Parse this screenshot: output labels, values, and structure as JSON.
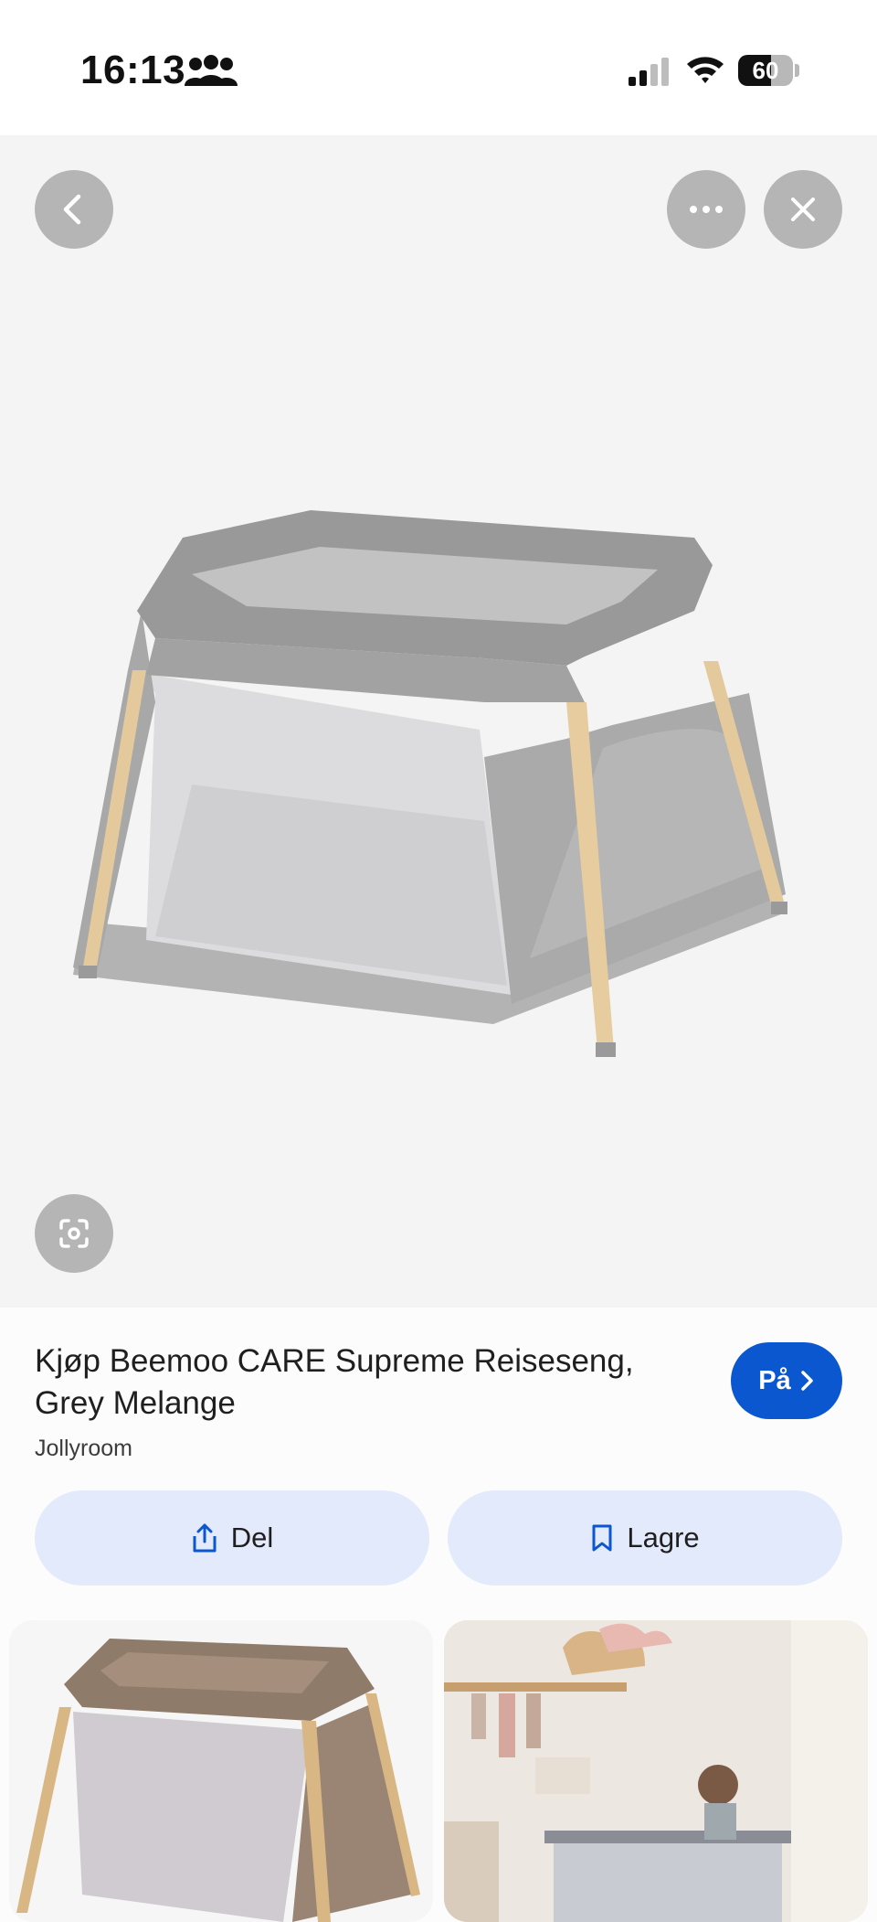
{
  "status_bar": {
    "time": "16:13",
    "people_icon": "people-icon",
    "battery_level": "60",
    "battery_fraction": 0.6
  },
  "image_viewer": {
    "back_icon": "chevron-left-icon",
    "more_icon": "more-horizontal-icon",
    "close_icon": "close-icon",
    "lens_icon": "lens-icon",
    "background_color": "#f4f4f4"
  },
  "result": {
    "title": "Kjøp Beemoo CARE Supreme Reiseseng, Grey Melange",
    "source": "Jollyroom",
    "visit_label": "På",
    "share_label": "Del",
    "save_label": "Lagre",
    "accent_color": "#0b57d0",
    "action_bg_color": "#e3eafc"
  },
  "related": {
    "items": [
      "thumbnail-beige-travel-cot",
      "thumbnail-nursery-scene"
    ]
  }
}
